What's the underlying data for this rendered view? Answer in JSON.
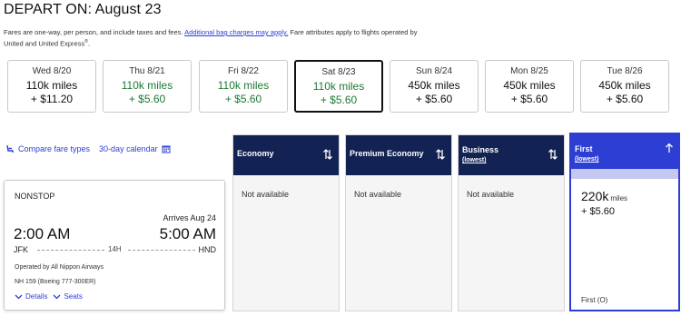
{
  "header": {
    "title": "DEPART ON: August 23",
    "note_start": "Fares are one-way, per person, and include taxes and fees.",
    "note_link": "Additional bag charges may apply.",
    "note_end": "Fare attributes apply to flights operated by United and United Express",
    "note_sup": "®",
    "note_period": "."
  },
  "dates": [
    {
      "day": "Wed 8/20",
      "miles": "110k miles",
      "price": "+ $11.20",
      "green": false,
      "selected": false
    },
    {
      "day": "Thu 8/21",
      "miles": "110k miles",
      "price": "+ $5.60",
      "green": true,
      "selected": false
    },
    {
      "day": "Fri 8/22",
      "miles": "110k miles",
      "price": "+ $5.60",
      "green": true,
      "selected": false
    },
    {
      "day": "Sat 8/23",
      "miles": "110k miles",
      "price": "+ $5.60",
      "green": true,
      "selected": true
    },
    {
      "day": "Sun 8/24",
      "miles": "450k miles",
      "price": "+ $5.60",
      "green": false,
      "selected": false
    },
    {
      "day": "Mon 8/25",
      "miles": "450k miles",
      "price": "+ $5.60",
      "green": false,
      "selected": false
    },
    {
      "day": "Tue 8/26",
      "miles": "450k miles",
      "price": "+ $5.60",
      "green": false,
      "selected": false
    }
  ],
  "tools": {
    "compare": "Compare fare types",
    "calendar": "30-day calendar"
  },
  "flight": {
    "stops": "NONSTOP",
    "arrives": "Arrives Aug 24",
    "depart_time": "2:00 AM",
    "arrive_time": "5:00 AM",
    "origin": "JFK",
    "duration": "14H",
    "destination": "HND",
    "operator": "Operated by All Nippon Airways",
    "flight_no": "NH 159 (Boeing 777-300ER)",
    "details": "Details",
    "seats": "Seats"
  },
  "columns": [
    {
      "name": "Economy",
      "sub": "",
      "status": "Not available"
    },
    {
      "name": "Premium Economy",
      "sub": "",
      "status": "Not available"
    },
    {
      "name": "Business",
      "sub": "(lowest)",
      "status": "Not available"
    }
  ],
  "first": {
    "name": "First",
    "sub": "(lowest)",
    "miles": "220k",
    "miles_unit": "miles",
    "tax": "+ $5.60",
    "seats": "First (O)"
  },
  "colors": {
    "accent": "#2d3ed3",
    "header_navy": "#122353",
    "green": "#1e7a34"
  }
}
